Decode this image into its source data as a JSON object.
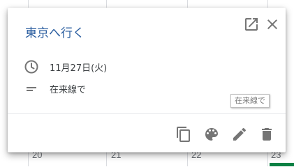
{
  "event": {
    "title": "東京へ行く",
    "date": "11月27日(火)",
    "description": "在来線で"
  },
  "tooltip": {
    "text": "在来線で"
  },
  "calendar": {
    "day_numbers": [
      "20",
      "21",
      "22",
      "23"
    ]
  },
  "icons": {
    "open": "open-in-new-icon",
    "close": "close-icon",
    "time": "clock-icon",
    "description": "notes-icon",
    "duplicate": "copy-icon",
    "color": "palette-icon",
    "edit": "pencil-icon",
    "delete": "trash-icon"
  },
  "colors": {
    "title": "#2a5d9f",
    "icon": "#757575",
    "event_chip": "#0b8043"
  }
}
